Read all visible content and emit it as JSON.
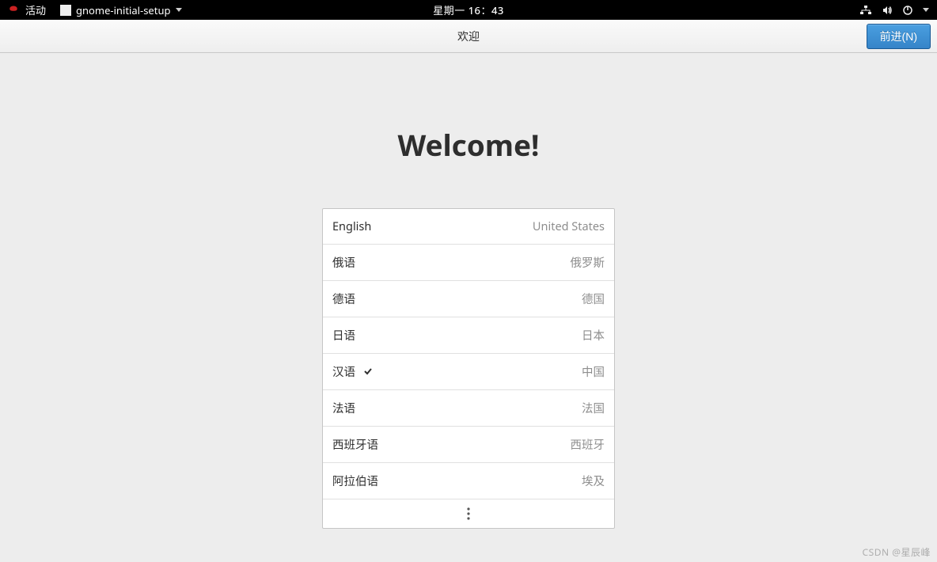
{
  "topbar": {
    "activities": "活动",
    "app_name": "gnome-initial-setup",
    "datetime": "星期一 16：43"
  },
  "header": {
    "title": "欢迎",
    "next_button": "前进(N)"
  },
  "main": {
    "welcome_title": "Welcome!"
  },
  "languages": [
    {
      "name": "English",
      "country": "United States",
      "selected": false
    },
    {
      "name": "俄语",
      "country": "俄罗斯",
      "selected": false
    },
    {
      "name": "德语",
      "country": "德国",
      "selected": false
    },
    {
      "name": "日语",
      "country": "日本",
      "selected": false
    },
    {
      "name": "汉语",
      "country": "中国",
      "selected": true
    },
    {
      "name": "法语",
      "country": "法国",
      "selected": false
    },
    {
      "name": "西班牙语",
      "country": "西班牙",
      "selected": false
    },
    {
      "name": "阿拉伯语",
      "country": "埃及",
      "selected": false
    }
  ],
  "watermark": "CSDN @星辰峰"
}
